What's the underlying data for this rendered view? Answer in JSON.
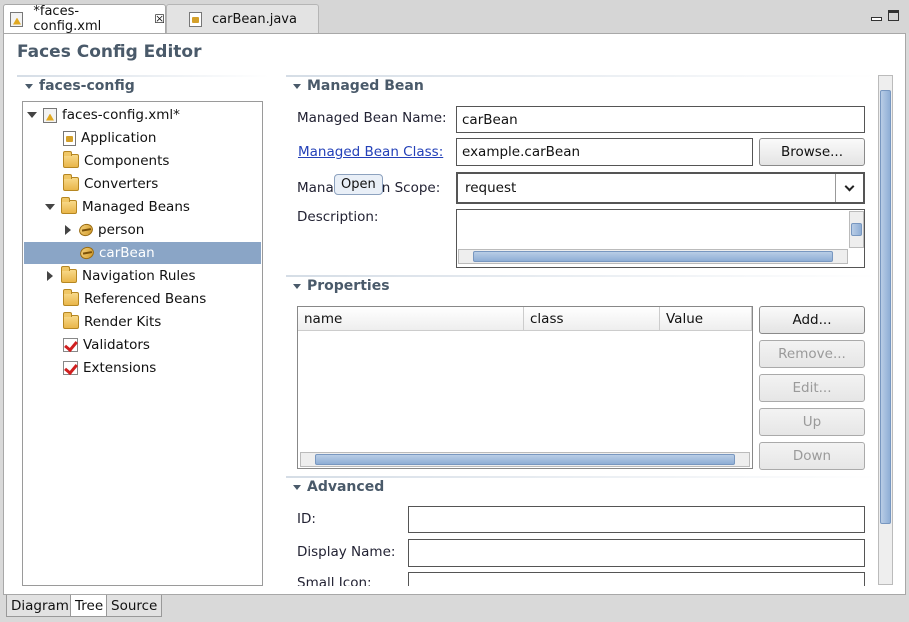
{
  "tabs": [
    {
      "label": "*faces-config.xml",
      "icon": "xml-file-icon",
      "active": true
    },
    {
      "label": "carBean.java",
      "icon": "java-file-icon",
      "active": false
    }
  ],
  "editor": {
    "title": "Faces Config Editor"
  },
  "tree": {
    "section_title": "faces-config",
    "root": "faces-config.xml*",
    "items": [
      {
        "label": "Application",
        "icon": "application-icon"
      },
      {
        "label": "Components",
        "icon": "folder-icon"
      },
      {
        "label": "Converters",
        "icon": "folder-icon"
      },
      {
        "label": "Managed Beans",
        "icon": "folder-icon"
      },
      {
        "label": "person",
        "icon": "bean-icon"
      },
      {
        "label": "carBean",
        "icon": "bean-icon",
        "selected": true
      },
      {
        "label": "Navigation Rules",
        "icon": "folder-icon"
      },
      {
        "label": "Referenced Beans",
        "icon": "folder-icon"
      },
      {
        "label": "Render Kits",
        "icon": "folder-icon"
      },
      {
        "label": "Validators",
        "icon": "check-icon"
      },
      {
        "label": "Extensions",
        "icon": "check-icon"
      }
    ]
  },
  "managed_bean": {
    "section_title": "Managed Bean",
    "name_label": "Managed Bean Name:",
    "name_value": "carBean",
    "class_label": "Managed Bean Class:",
    "class_value": "example.carBean",
    "browse_label": "Browse...",
    "scope_label_start": "Mana",
    "scope_label_end": "n Scope:",
    "scope_value": "request",
    "tooltip": "Open",
    "description_label": "Description:"
  },
  "properties": {
    "section_title": "Properties",
    "columns": [
      "name",
      "class",
      "Value"
    ],
    "buttons": {
      "add": "Add...",
      "remove": "Remove...",
      "edit": "Edit...",
      "up": "Up",
      "down": "Down"
    }
  },
  "advanced": {
    "section_title": "Advanced",
    "id_label": "ID:",
    "display_name_label": "Display Name:",
    "small_icon_label": "Small Icon:"
  },
  "bottom_tabs": [
    {
      "label": "Diagram",
      "active": false
    },
    {
      "label": "Tree",
      "active": true
    },
    {
      "label": "Source",
      "active": false
    }
  ]
}
